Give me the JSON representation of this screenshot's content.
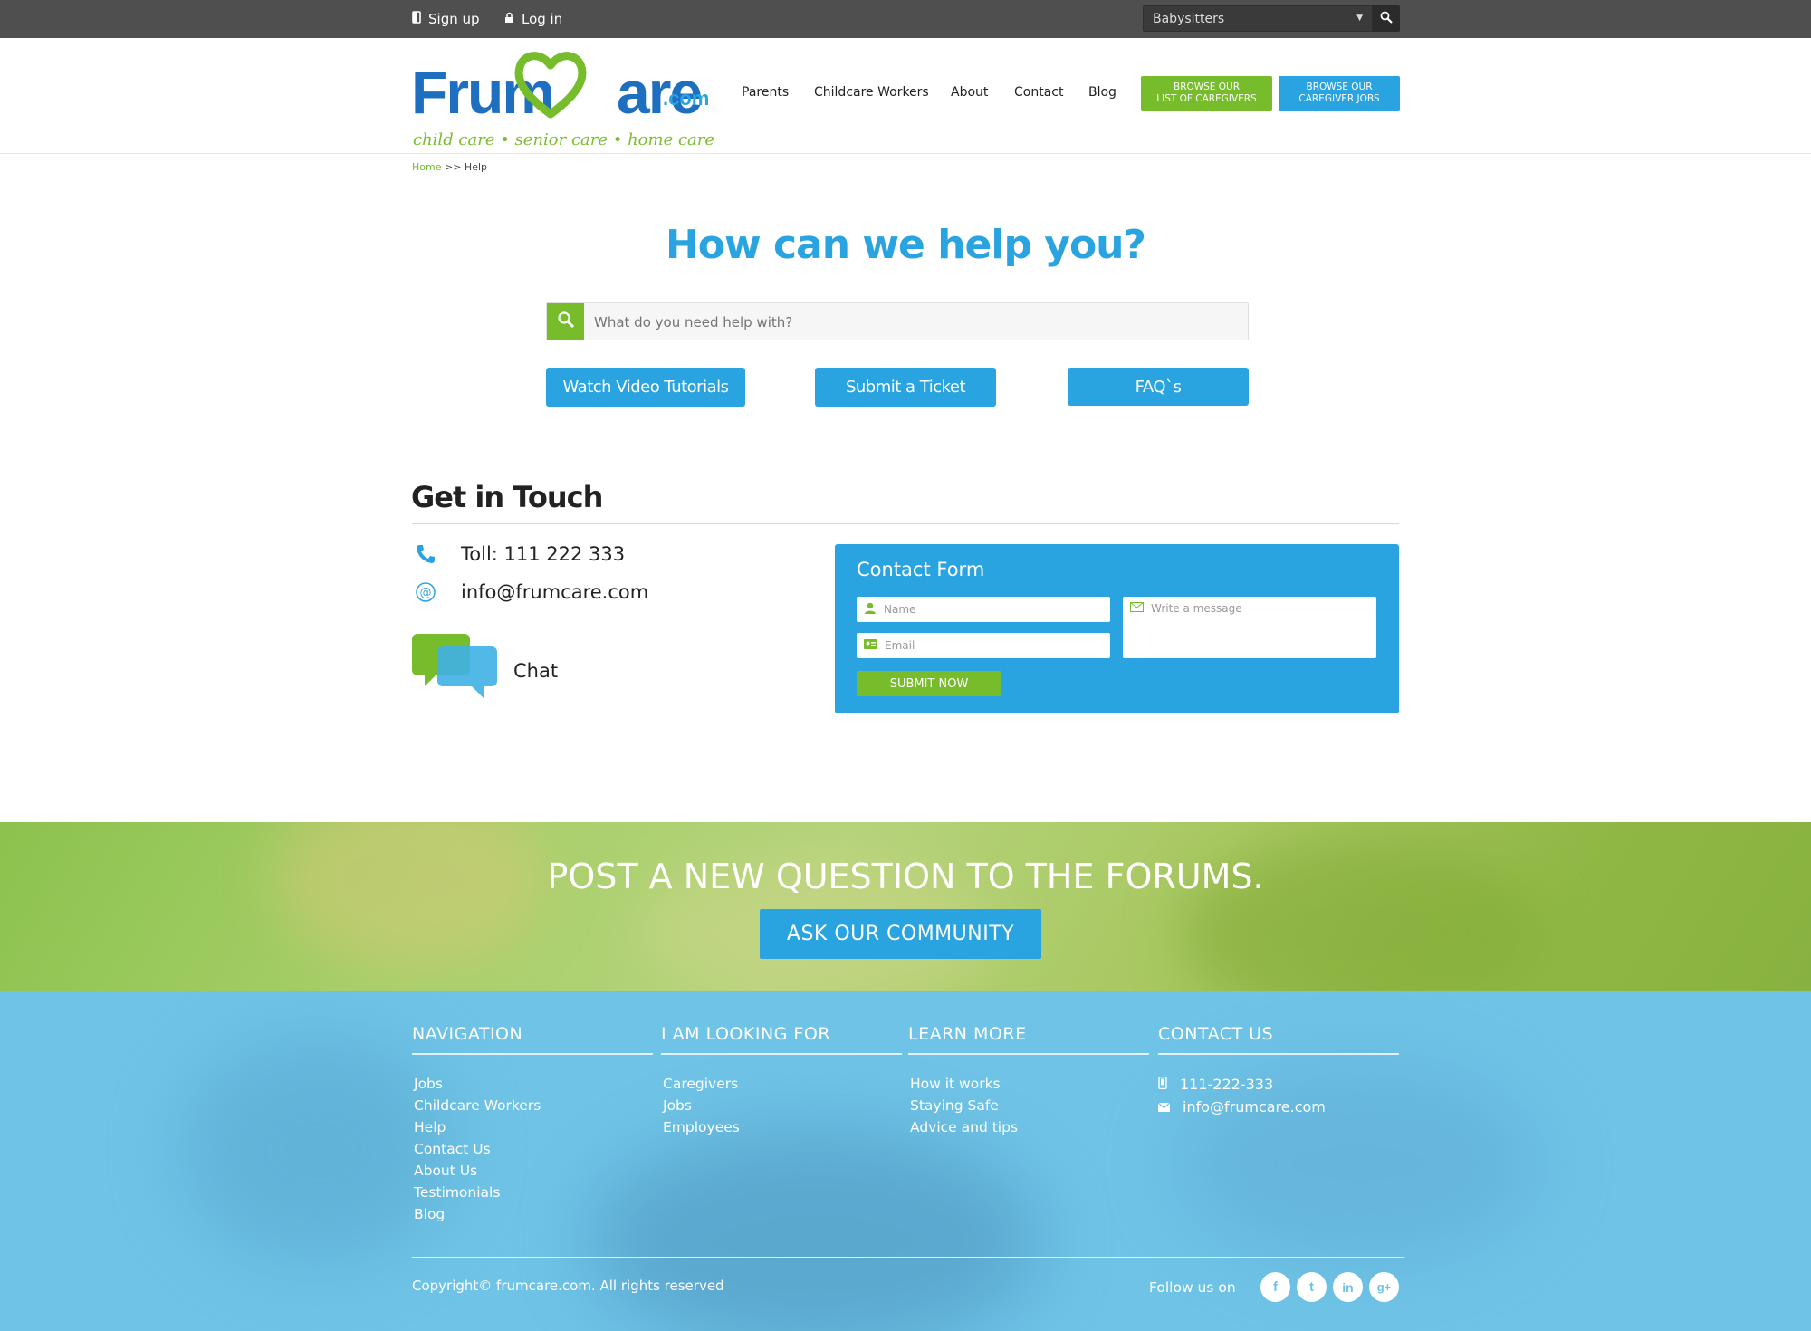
{
  "topbar": {
    "signup": "Sign up",
    "login": "Log in",
    "category_select": "Babysitters"
  },
  "logo": {
    "name_part1": "Frum",
    "name_part2": "are",
    "domain": ".com",
    "tagline": "child care • senior care • home care"
  },
  "nav": {
    "items": [
      "Parents",
      "Childcare Workers",
      "About",
      "Contact",
      "Blog"
    ],
    "browse_caregivers": [
      "BROWSE OUR",
      "LIST OF CAREGIVERS"
    ],
    "browse_jobs": [
      "BROWSE OUR",
      "CAREGIVER JOBS"
    ]
  },
  "breadcrumb": {
    "home": "Home",
    "separator": " >> ",
    "current": "Help"
  },
  "help": {
    "title": "How can we help you?",
    "search_placeholder": "What do you need help with?",
    "buttons": [
      "Watch Video Tutorials",
      "Submit a Ticket",
      "FAQ`s"
    ]
  },
  "get_in_touch": {
    "title": "Get in Touch",
    "toll": "Toll: 111 222 333",
    "email": "info@frumcare.com",
    "chat": "Chat"
  },
  "contact_form": {
    "title": "Contact Form",
    "name_placeholder": "Name",
    "email_placeholder": "Email",
    "message_placeholder": "Write a message",
    "submit": "SUBMIT NOW"
  },
  "forum": {
    "title": "POST A NEW QUESTION TO THE FORUMS.",
    "button": "ASK OUR COMMUNITY"
  },
  "footer": {
    "navigation": {
      "title": "NAVIGATION",
      "items": [
        "Jobs",
        "Childcare Workers",
        "Help",
        "Contact Us",
        "About Us",
        "Testimonials",
        "Blog"
      ]
    },
    "looking_for": {
      "title": "I AM LOOKING FOR",
      "items": [
        "Caregivers",
        "Jobs",
        "Employees"
      ]
    },
    "learn_more": {
      "title": "LEARN MORE",
      "items": [
        "How it works",
        "Staying Safe",
        "Advice and tips"
      ]
    },
    "contact": {
      "title": "CONTACT US",
      "phone": "111-222-333",
      "email": "info@frumcare.com"
    },
    "copyright": "Copyright© frumcare.com. All rights reserved",
    "follow": "Follow us on",
    "social": [
      "f",
      "t",
      "in",
      "g+"
    ]
  },
  "colors": {
    "accent_blue": "#2aa4e0",
    "brand_green": "#77bc2b",
    "logo_blue": "#1f6fc0",
    "topbar": "#4f4f4f",
    "footer_blue": "#6ec3e6"
  }
}
